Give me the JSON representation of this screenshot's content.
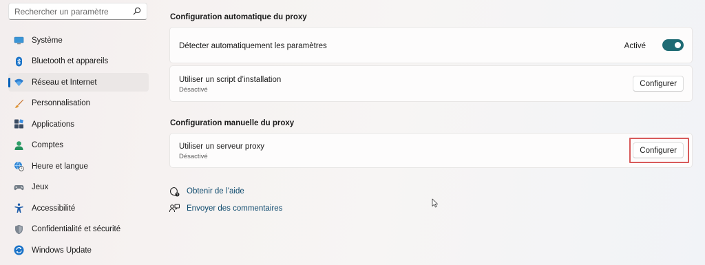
{
  "search": {
    "placeholder": "Rechercher un paramètre"
  },
  "sidebar": {
    "items": [
      {
        "label": "Système",
        "icon": "monitor-icon"
      },
      {
        "label": "Bluetooth et appareils",
        "icon": "bluetooth-icon"
      },
      {
        "label": "Réseau et Internet",
        "icon": "wifi-icon",
        "active": true
      },
      {
        "label": "Personnalisation",
        "icon": "brush-icon"
      },
      {
        "label": "Applications",
        "icon": "apps-icon"
      },
      {
        "label": "Comptes",
        "icon": "person-icon"
      },
      {
        "label": "Heure et langue",
        "icon": "globe-clock-icon"
      },
      {
        "label": "Jeux",
        "icon": "gamepad-icon"
      },
      {
        "label": "Accessibilité",
        "icon": "accessibility-icon"
      },
      {
        "label": "Confidentialité et sécurité",
        "icon": "shield-icon"
      },
      {
        "label": "Windows Update",
        "icon": "sync-icon"
      }
    ]
  },
  "auto_proxy": {
    "title": "Configuration automatique du proxy",
    "detect": {
      "label": "Détecter automatiquement les paramètres",
      "state_label": "Activé",
      "on": true
    },
    "script": {
      "label": "Utiliser un script d’installation",
      "sublabel": "Désactivé",
      "button": "Configurer"
    }
  },
  "manual_proxy": {
    "title": "Configuration manuelle du proxy",
    "server": {
      "label": "Utiliser un serveur proxy",
      "sublabel": "Désactivé",
      "button": "Configurer"
    }
  },
  "links": {
    "help": "Obtenir de l’aide",
    "feedback": "Envoyer des commentaires"
  },
  "colors": {
    "accent": "#005fb8",
    "toggle_on": "#1f6b74",
    "highlight": "#d85a5a",
    "link": "#0e4a6e"
  }
}
